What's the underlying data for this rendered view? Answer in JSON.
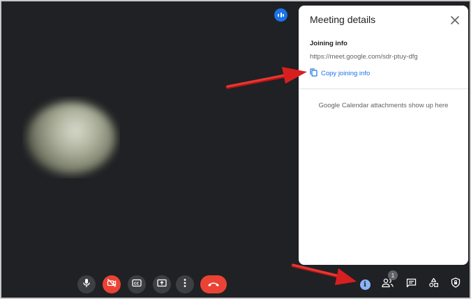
{
  "panel": {
    "title": "Meeting details",
    "joining_label": "Joining info",
    "meet_url": "https://meet.google.com/sdr-ptuy-dfg",
    "copy_label": "Copy joining info",
    "attachments_note": "Google Calendar attachments show up here"
  },
  "controls": {
    "icons": [
      "mic-icon",
      "camera-off-icon",
      "captions-icon",
      "present-screen-icon",
      "more-options-icon",
      "end-call-icon"
    ]
  },
  "side_controls": {
    "participant_count": "1",
    "icons": [
      "meeting-details-icon",
      "people-icon",
      "chat-icon",
      "activities-icon",
      "host-controls-icon"
    ]
  },
  "colors": {
    "background": "#202124",
    "accent": "#1a73e8",
    "danger": "#ea4335",
    "info_active": "#8ab4f8",
    "annotation_arrow": "#d81f1f"
  }
}
